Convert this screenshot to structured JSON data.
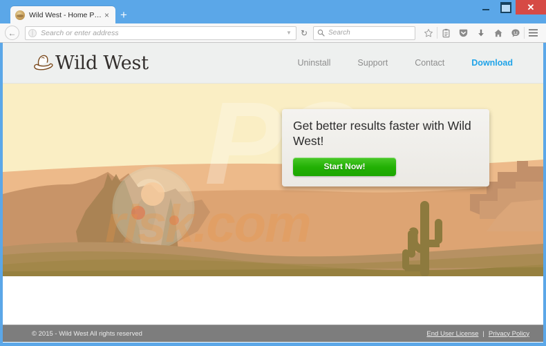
{
  "browser": {
    "tab": {
      "title": "Wild West - Home Page",
      "favicon_icon": "cowboy-hat-favicon",
      "close_icon": "×"
    },
    "new_tab_icon": "+",
    "window_controls": {
      "minimize_icon": "minimize-icon",
      "maximize_icon": "maximize-icon",
      "close_icon": "✕"
    },
    "nav": {
      "back_icon": "←",
      "identity_icon": "globe-icon",
      "url_placeholder": "Search or enter address",
      "dropdown_icon": "▼",
      "reload_icon": "⟳",
      "search_placeholder": "Search",
      "search_icon": "magnifier-icon"
    },
    "toolbar_icons": [
      {
        "name": "bookmark-star-icon",
        "glyph": "☆"
      },
      {
        "name": "reader-mode-icon",
        "glyph": "Ὄb"
      },
      {
        "name": "pocket-icon",
        "glyph": "pocket"
      },
      {
        "name": "downloads-icon",
        "glyph": "⬇"
      },
      {
        "name": "home-icon",
        "glyph": "⌂"
      },
      {
        "name": "sync-smiley-icon",
        "glyph": "☺"
      },
      {
        "name": "hamburger-menu-icon",
        "glyph": "☰"
      }
    ]
  },
  "site": {
    "brand": {
      "name": "Wild West",
      "logo_icon": "cowboy-hat-logo"
    },
    "nav": [
      {
        "label": "Uninstall",
        "accent": false
      },
      {
        "label": "Support",
        "accent": false
      },
      {
        "label": "Contact",
        "accent": false
      },
      {
        "label": "Download",
        "accent": true
      }
    ],
    "accent_color": "#1fa3e8",
    "hero": {
      "sky_color": "#faeec4",
      "sand_color": "#dba870",
      "mesa_color": "#c89468",
      "foreground_color": "#96803f",
      "sun_color": "#f7c99a",
      "cactus_color": "#8d7a3e",
      "watermark_top": "PC",
      "watermark_bottom": "risk.com"
    },
    "popup": {
      "headline": "Get better results faster with Wild West!",
      "cta_label": "Start Now!",
      "cta_color": "#22b004"
    },
    "footer": {
      "copyright": "© 2015 - Wild West All rights reserved",
      "links": [
        {
          "label": "End User License"
        },
        {
          "label": "Privacy Policy"
        }
      ],
      "separator": "|"
    }
  }
}
